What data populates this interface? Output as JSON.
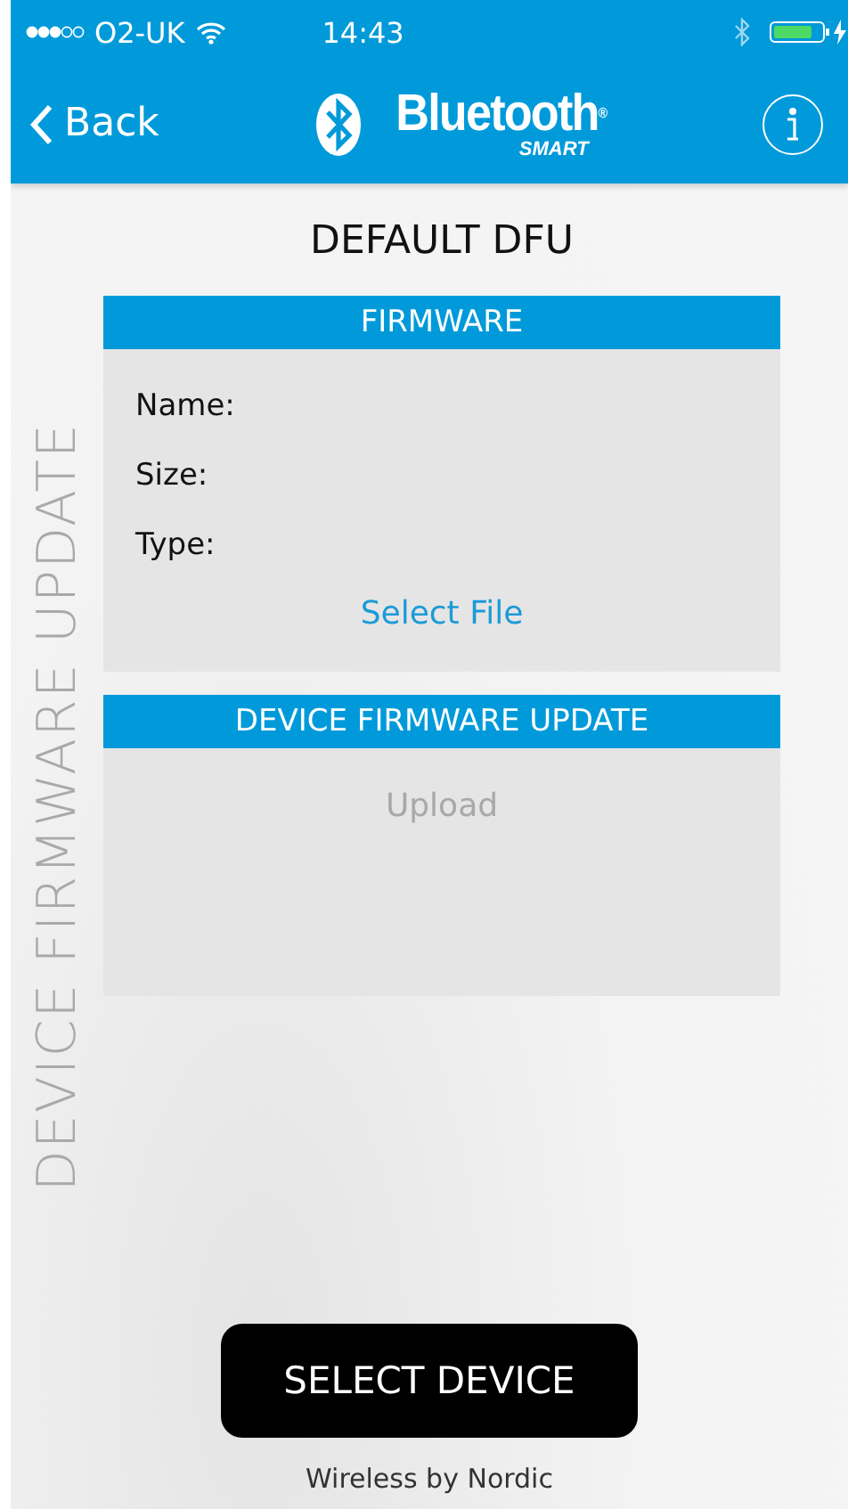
{
  "status_bar": {
    "carrier": "O2-UK",
    "time": "14:43"
  },
  "nav": {
    "back": "Back",
    "logo_text": "Bluetooth$^{®}$",
    "logo_sub": "SMART"
  },
  "side_title": "DEVICE FIRMWARE UPDATE",
  "title": "DEFAULT DFU",
  "firmware": {
    "header": "FIRMWARE",
    "fields": [
      {
        "label": "Name:"
      },
      {
        "label": "Size:"
      },
      {
        "label": "Type:"
      }
    ],
    "action": {
      "label": "Select File",
      "disabled": false
    }
  },
  "dfu": {
    "header": "DEVICE FIRMWARE UPDATE",
    "action": {
      "label": "Upload",
      "disabled": true
    }
  },
  "select_button": "SELECT DEVICE",
  "footer": "Wireless by Nordic"
}
